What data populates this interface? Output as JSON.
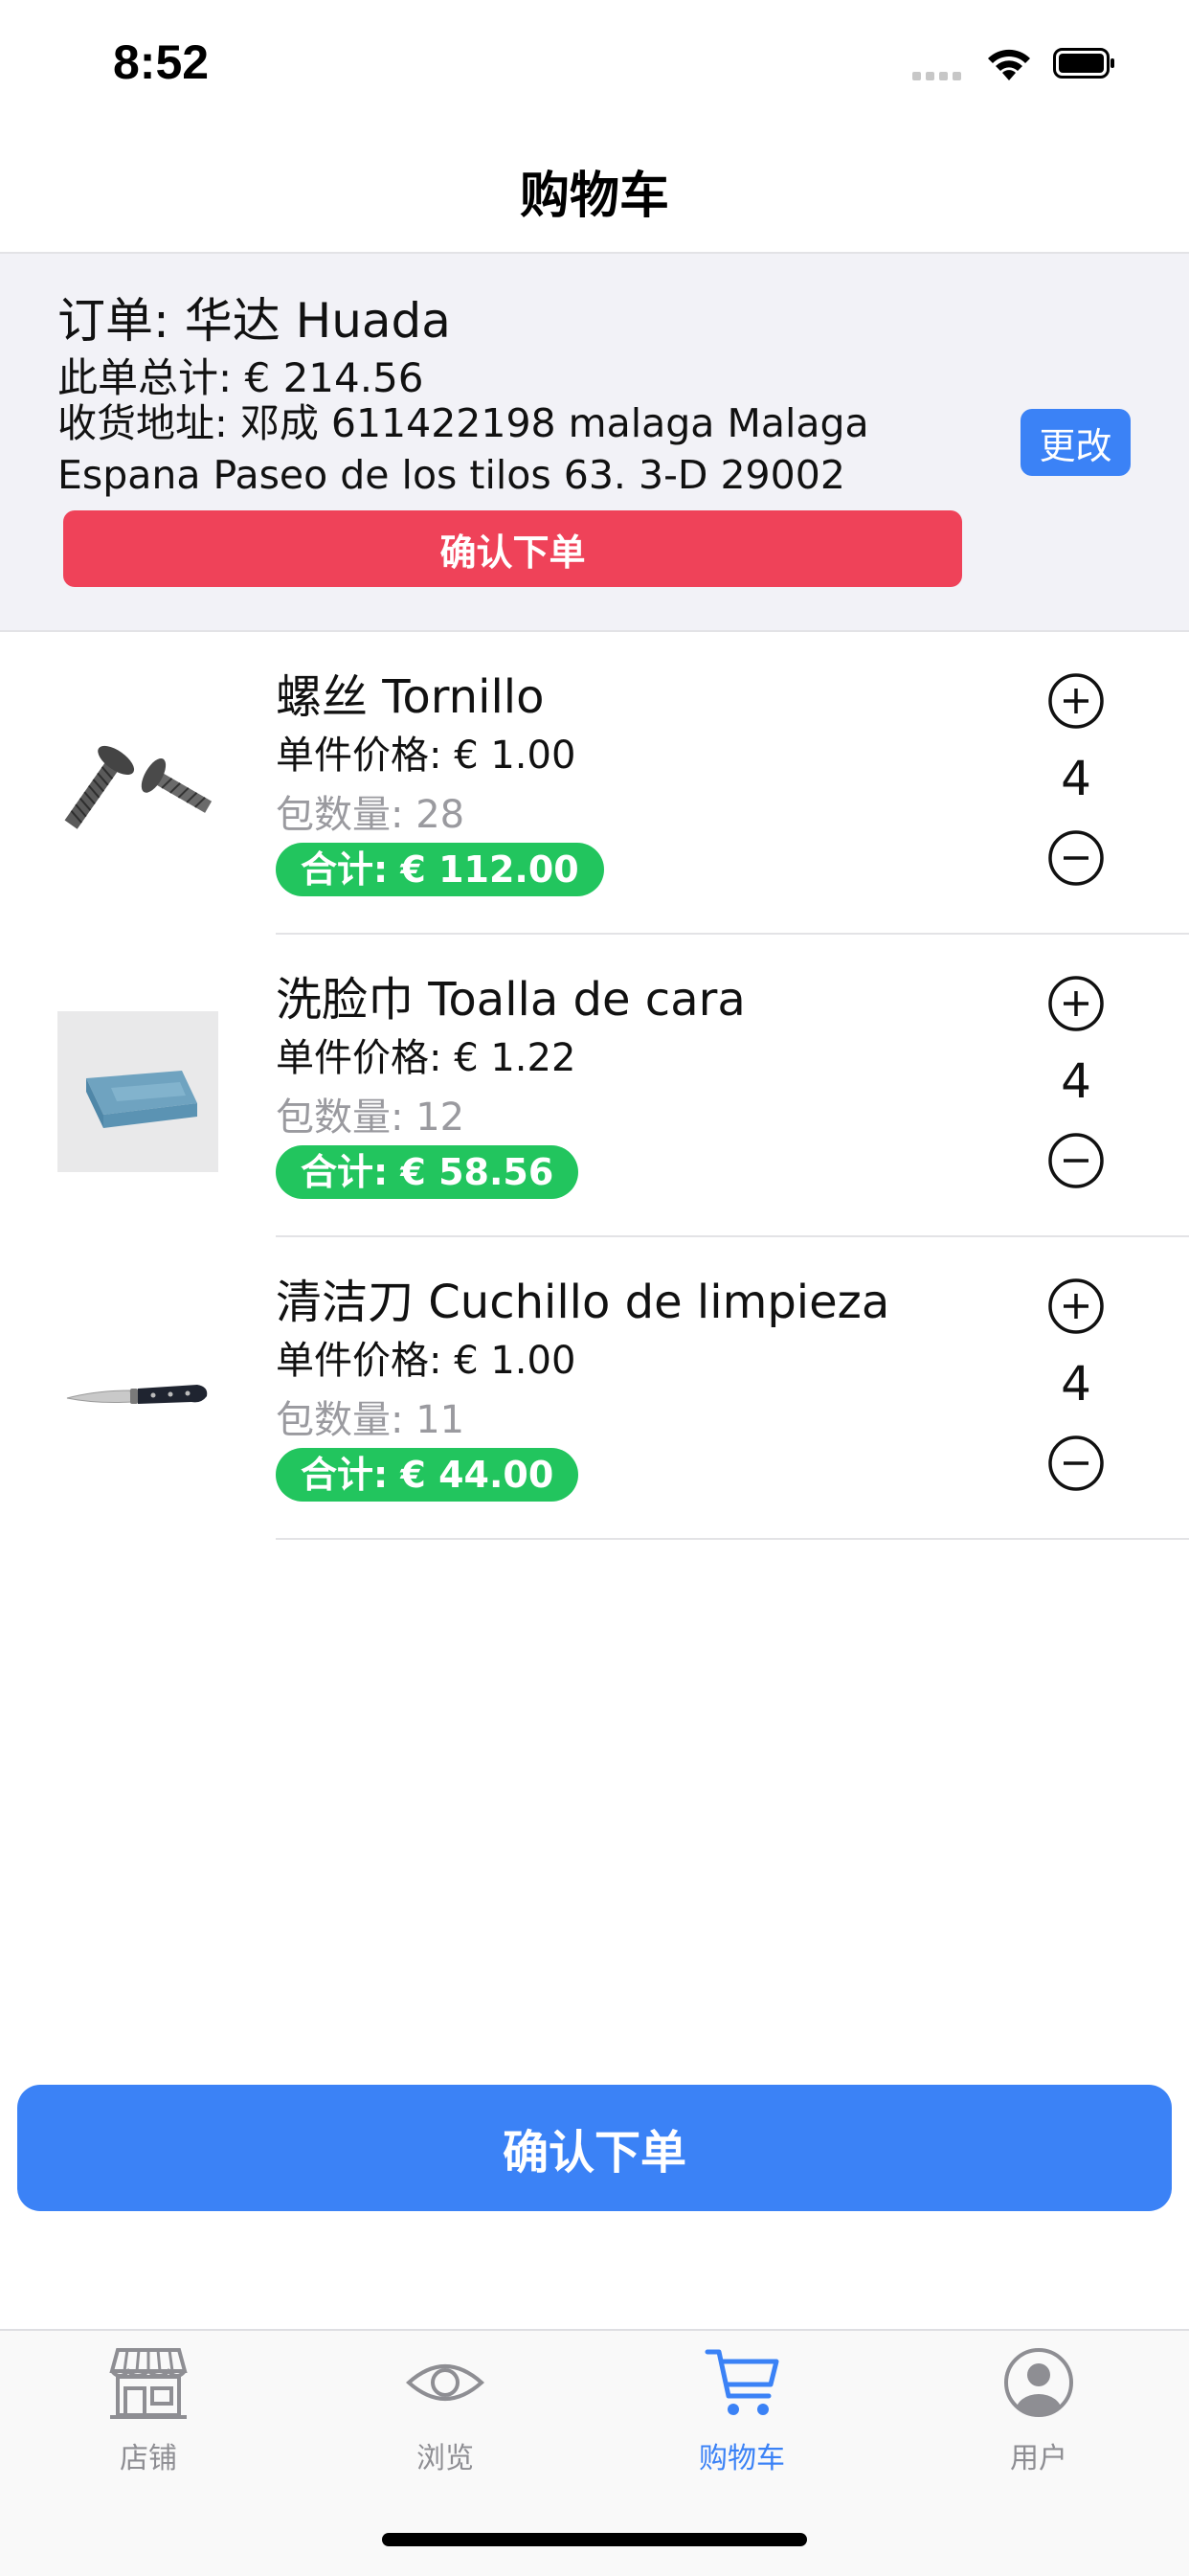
{
  "status_bar": {
    "time": "8:52"
  },
  "nav": {
    "title": "购物车"
  },
  "order": {
    "title": "订单: 华达 Huada",
    "total": "此单总计: € 214.56",
    "address": "收货地址: 邓成 611422198 malaga Malaga Espana Paseo de los tilos 63. 3-D 29002",
    "change_label": "更改",
    "confirm_label": "确认下单"
  },
  "items": [
    {
      "name": "螺丝 Tornillo",
      "unit_price": "单件价格: € 1.00",
      "pack_qty": "包数量: 28",
      "subtotal": "合计: € 112.00",
      "quantity": "4",
      "image_icon": "screw-image"
    },
    {
      "name": "洗脸巾 Toalla de cara",
      "unit_price": "单件价格: € 1.22",
      "pack_qty": "包数量: 12",
      "subtotal": "合计: € 58.56",
      "quantity": "4",
      "image_icon": "towel-image"
    },
    {
      "name": "清洁刀 Cuchillo de limpieza",
      "unit_price": "单件价格: € 1.00",
      "pack_qty": "包数量: 11",
      "subtotal": "合计: € 44.00",
      "quantity": "4",
      "image_icon": "knife-image"
    }
  ],
  "confirm_main_label": "确认下单",
  "tabs": [
    {
      "label": "店铺",
      "icon": "store-icon",
      "active": false
    },
    {
      "label": "浏览",
      "icon": "eye-icon",
      "active": false
    },
    {
      "label": "购物车",
      "icon": "cart-icon",
      "active": true
    },
    {
      "label": "用户",
      "icon": "user-icon",
      "active": false
    }
  ],
  "colors": {
    "accent_blue": "#3b82f6",
    "confirm_red": "#ef4259",
    "subtotal_green": "#22c55e",
    "panel_gray": "#f2f2f7",
    "inactive_tab": "#8e8e93"
  }
}
